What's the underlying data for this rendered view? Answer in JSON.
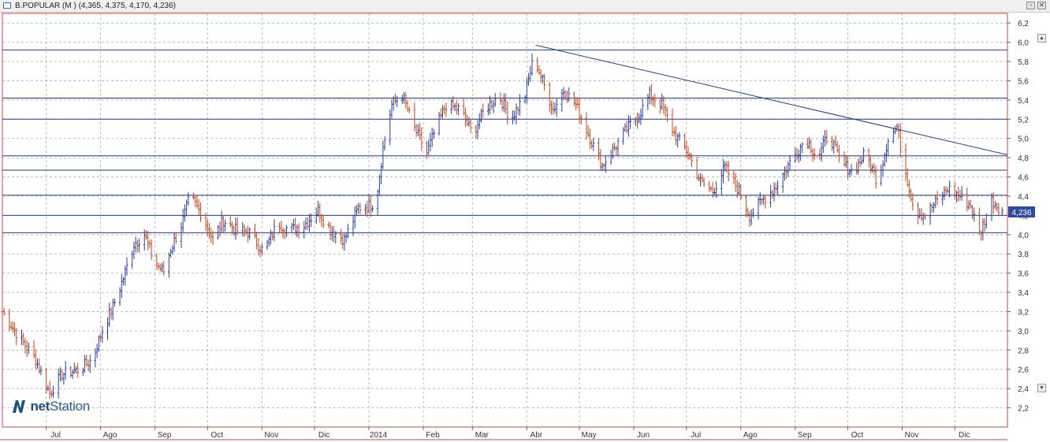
{
  "window": {
    "title": "B.POPULAR (M ) (4,365, 4,375, 4,170, 4,236)",
    "restore_glyph": "▫",
    "close_glyph": "✕",
    "icon": "window-icon"
  },
  "logo": {
    "brand_a": "net",
    "brand_b": "Station",
    "icon": "netstation-logo-icon"
  },
  "scrollbar": {
    "up_glyph": "▲",
    "down_glyph": "▼"
  },
  "colors": {
    "up_bar": "#2a3f9c",
    "down_bar": "#c0481f",
    "frame": "#c64848",
    "horizontal_lines": "#233c8a",
    "trend_line": "#233c8a",
    "last_price_label_bg": "#2e4a9a",
    "grid": "#b9b9b9"
  },
  "chart_data": {
    "type": "ohlc",
    "title": "B.POPULAR (M )",
    "last_ohlc": {
      "open": 4.365,
      "high": 4.375,
      "low": 4.17,
      "close": 4.236
    },
    "last_price_label": "4,236",
    "y_axis": {
      "range": [
        2.0,
        6.3
      ],
      "ticks": [
        2.2,
        2.4,
        2.6,
        2.8,
        3.0,
        3.2,
        3.4,
        3.6,
        3.8,
        4.0,
        4.2,
        4.4,
        4.6,
        4.8,
        5.0,
        5.2,
        5.4,
        5.6,
        5.8,
        6.0,
        6.2
      ],
      "tick_labels": [
        "2,2",
        "2,4",
        "2,6",
        "2,8",
        "3,0",
        "3,2",
        "3,4",
        "3,6",
        "3,8",
        "4,0",
        "4,2",
        "4,4",
        "4,6",
        "4,8",
        "5,0",
        "5,2",
        "5,4",
        "5,6",
        "5,8",
        "6,0",
        "6,2"
      ]
    },
    "x_axis": {
      "range": [
        "2013-06-06",
        "2014-12-31"
      ],
      "ticks": [
        {
          "date": "2013-07-01",
          "label": "Jul"
        },
        {
          "date": "2013-08-01",
          "label": "Ago"
        },
        {
          "date": "2013-09-01",
          "label": "Sep"
        },
        {
          "date": "2013-10-01",
          "label": "Oct"
        },
        {
          "date": "2013-11-01",
          "label": "Nov"
        },
        {
          "date": "2013-12-01",
          "label": "Dic"
        },
        {
          "date": "2014-01-01",
          "label": "2014"
        },
        {
          "date": "2014-02-01",
          "label": "Feb"
        },
        {
          "date": "2014-03-01",
          "label": "Mar"
        },
        {
          "date": "2014-04-01",
          "label": "Abr"
        },
        {
          "date": "2014-05-01",
          "label": "May"
        },
        {
          "date": "2014-06-01",
          "label": "Jun"
        },
        {
          "date": "2014-07-01",
          "label": "Jul"
        },
        {
          "date": "2014-08-01",
          "label": "Ago"
        },
        {
          "date": "2014-09-01",
          "label": "Sep"
        },
        {
          "date": "2014-10-01",
          "label": "Oct"
        },
        {
          "date": "2014-11-01",
          "label": "Nov"
        },
        {
          "date": "2014-12-01",
          "label": "Dic"
        }
      ]
    },
    "grid": true,
    "horizontal_lines": [
      5.92,
      5.42,
      5.2,
      4.82,
      4.67,
      4.41,
      4.2,
      4.02
    ],
    "trend_line": {
      "start": [
        "2014-04-06",
        5.97
      ],
      "end": [
        "2014-12-31",
        4.83
      ]
    },
    "price_path": [
      [
        "2013-06-06",
        3.2
      ],
      [
        "2013-06-15",
        2.95
      ],
      [
        "2013-06-25",
        2.7
      ],
      [
        "2013-07-03",
        2.35
      ],
      [
        "2013-07-10",
        2.55
      ],
      [
        "2013-07-20",
        2.6
      ],
      [
        "2013-07-27",
        2.7
      ],
      [
        "2013-08-02",
        3.0
      ],
      [
        "2013-08-08",
        3.25
      ],
      [
        "2013-08-14",
        3.55
      ],
      [
        "2013-08-20",
        3.9
      ],
      [
        "2013-08-26",
        4.0
      ],
      [
        "2013-09-01",
        3.7
      ],
      [
        "2013-09-06",
        3.62
      ],
      [
        "2013-09-10",
        3.85
      ],
      [
        "2013-09-16",
        4.1
      ],
      [
        "2013-09-21",
        4.4
      ],
      [
        "2013-09-28",
        4.2
      ],
      [
        "2013-10-04",
        3.95
      ],
      [
        "2013-10-10",
        4.15
      ],
      [
        "2013-10-17",
        4.05
      ],
      [
        "2013-10-25",
        4.02
      ],
      [
        "2013-11-02",
        3.82
      ],
      [
        "2013-11-10",
        4.12
      ],
      [
        "2013-11-17",
        4.05
      ],
      [
        "2013-11-25",
        4.1
      ],
      [
        "2013-12-03",
        4.25
      ],
      [
        "2013-12-10",
        4.05
      ],
      [
        "2013-12-18",
        3.95
      ],
      [
        "2013-12-26",
        4.28
      ],
      [
        "2014-01-01",
        4.3
      ],
      [
        "2014-01-05",
        4.35
      ],
      [
        "2014-01-09",
        4.9
      ],
      [
        "2014-01-14",
        5.35
      ],
      [
        "2014-01-20",
        5.45
      ],
      [
        "2014-01-27",
        5.1
      ],
      [
        "2014-02-03",
        4.85
      ],
      [
        "2014-02-08",
        5.1
      ],
      [
        "2014-02-14",
        5.35
      ],
      [
        "2014-02-22",
        5.3
      ],
      [
        "2014-03-01",
        5.05
      ],
      [
        "2014-03-08",
        5.3
      ],
      [
        "2014-03-16",
        5.45
      ],
      [
        "2014-03-23",
        5.2
      ],
      [
        "2014-03-31",
        5.45
      ],
      [
        "2014-04-05",
        5.85
      ],
      [
        "2014-04-10",
        5.6
      ],
      [
        "2014-04-16",
        5.3
      ],
      [
        "2014-04-22",
        5.5
      ],
      [
        "2014-04-29",
        5.35
      ],
      [
        "2014-05-06",
        5.05
      ],
      [
        "2014-05-14",
        4.72
      ],
      [
        "2014-05-21",
        4.9
      ],
      [
        "2014-05-28",
        5.1
      ],
      [
        "2014-06-04",
        5.25
      ],
      [
        "2014-06-10",
        5.45
      ],
      [
        "2014-06-17",
        5.35
      ],
      [
        "2014-06-24",
        5.05
      ],
      [
        "2014-07-02",
        4.85
      ],
      [
        "2014-07-09",
        4.55
      ],
      [
        "2014-07-16",
        4.45
      ],
      [
        "2014-07-23",
        4.7
      ],
      [
        "2014-07-31",
        4.45
      ],
      [
        "2014-08-06",
        4.2
      ],
      [
        "2014-08-13",
        4.35
      ],
      [
        "2014-08-21",
        4.5
      ],
      [
        "2014-08-29",
        4.75
      ],
      [
        "2014-09-07",
        5.0
      ],
      [
        "2014-09-14",
        4.8
      ],
      [
        "2014-09-20",
        5.05
      ],
      [
        "2014-09-27",
        4.75
      ],
      [
        "2014-10-04",
        4.65
      ],
      [
        "2014-10-11",
        4.85
      ],
      [
        "2014-10-18",
        4.55
      ],
      [
        "2014-10-24",
        5.0
      ],
      [
        "2014-10-29",
        5.12
      ],
      [
        "2014-11-03",
        4.65
      ],
      [
        "2014-11-08",
        4.25
      ],
      [
        "2014-11-14",
        4.2
      ],
      [
        "2014-11-21",
        4.35
      ],
      [
        "2014-11-27",
        4.48
      ],
      [
        "2014-12-04",
        4.4
      ],
      [
        "2014-12-10",
        4.3
      ],
      [
        "2014-12-15",
        4.0
      ],
      [
        "2014-12-22",
        4.36
      ],
      [
        "2014-12-28",
        4.25
      ]
    ]
  }
}
